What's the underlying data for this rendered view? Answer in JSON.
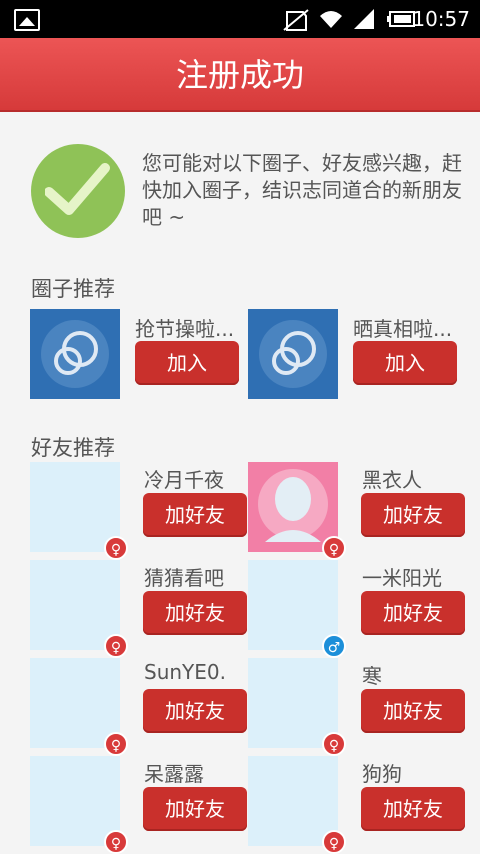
{
  "status_bar": {
    "time": "10:57"
  },
  "header": {
    "title": "注册成功"
  },
  "intro": {
    "text": "您可能对以下圈子、好友感兴趣，赶快加入圈子，结识志同道合的新朋友吧 ~"
  },
  "circles_section": {
    "title": "圈子推荐",
    "items": [
      {
        "name": "抢节操啦...",
        "button": "加入"
      },
      {
        "name": "晒真相啦...",
        "button": "加入"
      }
    ]
  },
  "friends_section": {
    "title": "好友推荐",
    "items": [
      {
        "name": "冷月千夜",
        "button": "加好友",
        "gender": "female"
      },
      {
        "name": "黑衣人",
        "button": "加好友",
        "gender": "female"
      },
      {
        "name": "猜猜看吧",
        "button": "加好友",
        "gender": "female"
      },
      {
        "name": "一米阳光",
        "button": "加好友",
        "gender": "male"
      },
      {
        "name": "SunYE0.",
        "button": "加好友",
        "gender": "female"
      },
      {
        "name": "寒",
        "button": "加好友",
        "gender": "female"
      },
      {
        "name": "呆露露",
        "button": "加好友",
        "gender": "female"
      },
      {
        "name": "狗狗",
        "button": "加好友",
        "gender": "female"
      }
    ]
  },
  "colors": {
    "header": "#e04848",
    "button": "#c9302c",
    "circle_bg": "#2f6fb3",
    "check": "#8fc257"
  }
}
